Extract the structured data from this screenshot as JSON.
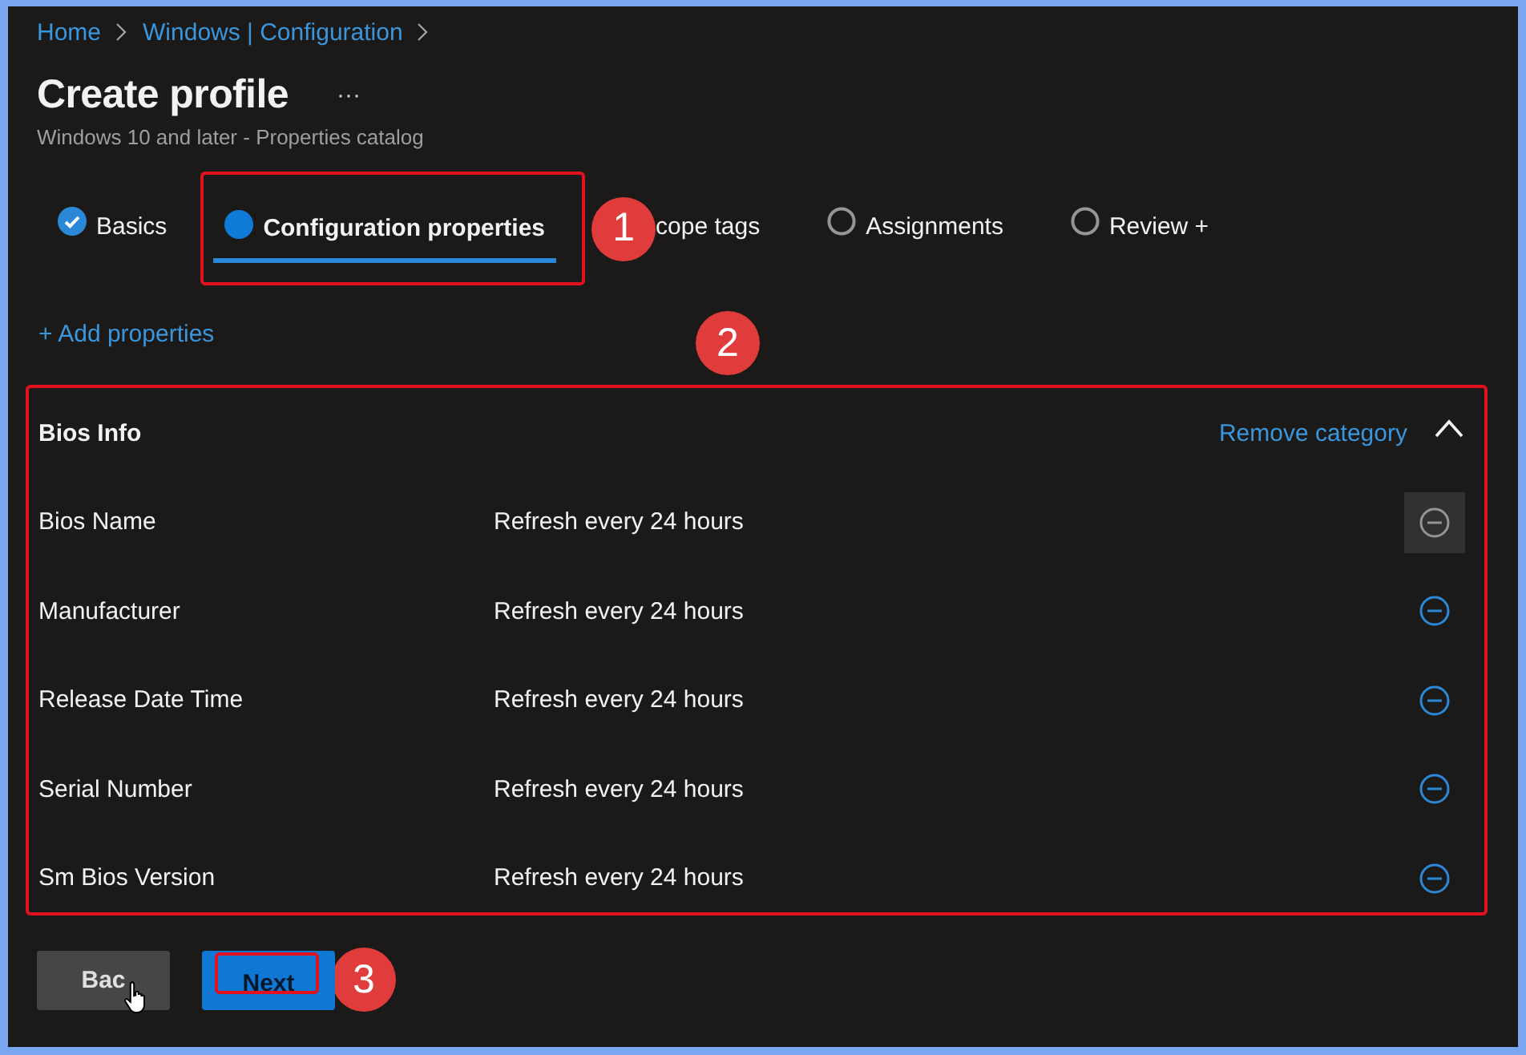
{
  "breadcrumb": [
    {
      "label": "Home"
    },
    {
      "label": "Windows | Configuration"
    }
  ],
  "title": "Create profile",
  "more": "···",
  "subtitle": "Windows 10 and later - Properties catalog",
  "tabs": [
    {
      "label": "Basics",
      "kind": "done",
      "selected": false
    },
    {
      "label": "Configuration properties",
      "kind": "current",
      "selected": true
    },
    {
      "label": "cope tags",
      "selected": false
    },
    {
      "label": "Assignments",
      "kind": "pending",
      "selected": false
    },
    {
      "label": "Review +",
      "kind": "pending",
      "selected": false
    }
  ],
  "add_link": "+ Add properties",
  "category": {
    "name": "Bios Info",
    "action": "Remove category",
    "expanded": true,
    "rows": [
      {
        "name": "Bios Name",
        "value": "Refresh every 24 hours",
        "hovered": true
      },
      {
        "name": "Manufacturer",
        "value": "Refresh every 24 hours",
        "hovered": false
      },
      {
        "name": "Release Date Time",
        "value": "Refresh every 24 hours",
        "hovered": false
      },
      {
        "name": "Serial Number",
        "value": "Refresh every 24 hours",
        "hovered": false
      },
      {
        "name": "Sm Bios Version",
        "value": "Refresh every 24 hours",
        "hovered": false
      }
    ]
  },
  "buttons": [
    {
      "label": "Bac",
      "kind": "secondary"
    },
    {
      "label": "Next",
      "kind": "primary"
    }
  ],
  "annotations": [
    {
      "number": "1"
    },
    {
      "number": "2"
    },
    {
      "number": "3"
    }
  ]
}
